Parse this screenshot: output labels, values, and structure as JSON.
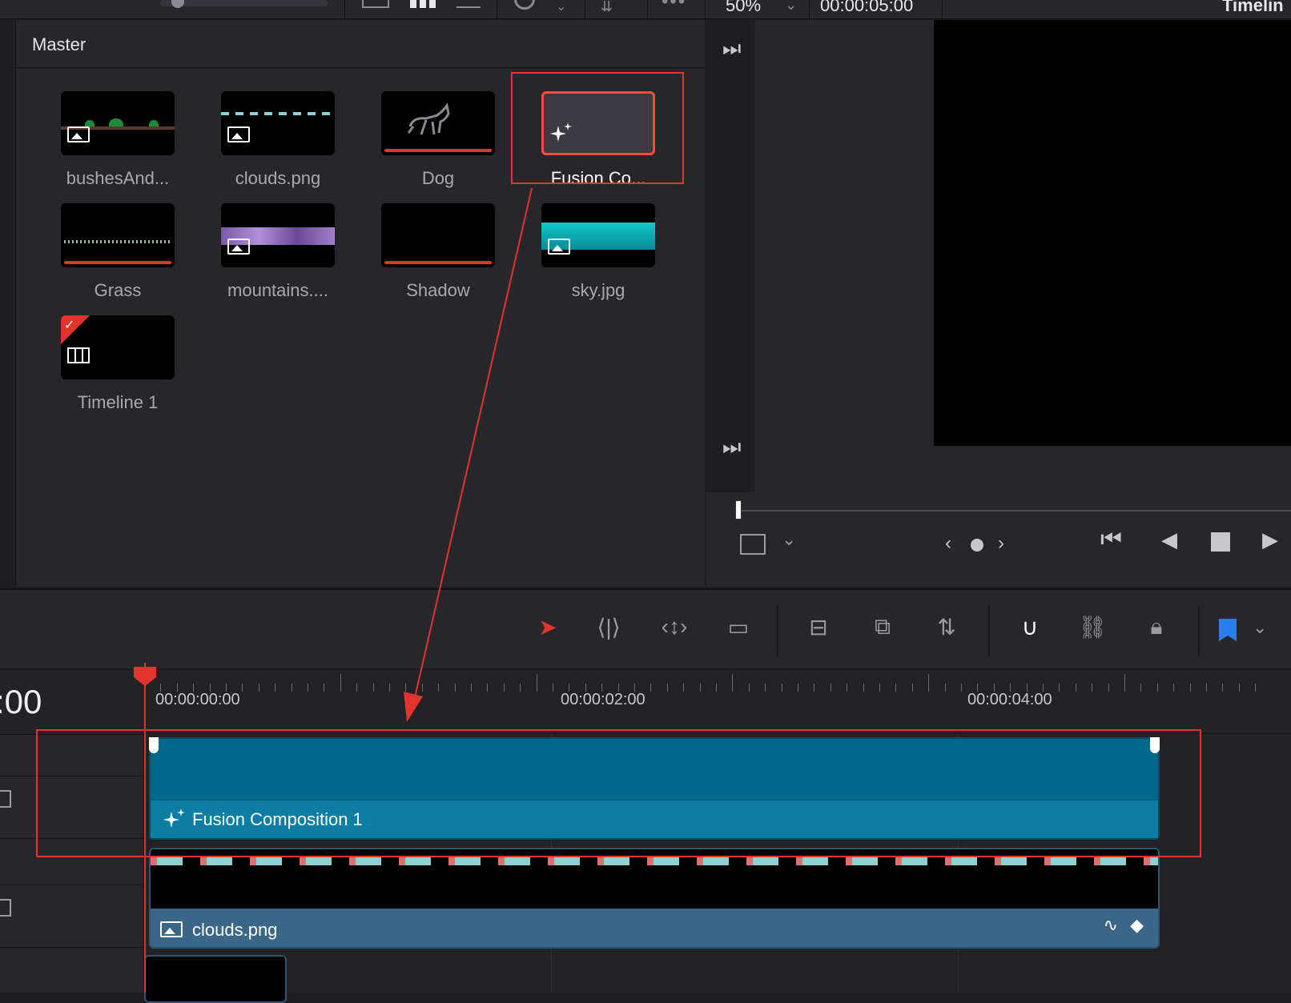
{
  "topbar": {
    "zoom": "50%",
    "timecode": "00:00:05:00",
    "panel_title": "Timelin"
  },
  "media_pool": {
    "folder": "Master",
    "clips": [
      {
        "name": "bushesAnd...",
        "type": "image"
      },
      {
        "name": "clouds.png",
        "type": "image"
      },
      {
        "name": "Dog",
        "type": "fusion"
      },
      {
        "name": "Fusion Co...",
        "type": "fusion",
        "selected": true
      },
      {
        "name": "Grass",
        "type": "fusion"
      },
      {
        "name": "mountains....",
        "type": "image"
      },
      {
        "name": "Shadow",
        "type": "fusion"
      },
      {
        "name": "sky.jpg",
        "type": "image"
      },
      {
        "name": "Timeline 1",
        "type": "timeline"
      }
    ]
  },
  "timeline": {
    "current_time": ":00",
    "ruler_labels": [
      "00:00:00:00",
      "00:00:02:00",
      "00:00:04:00"
    ],
    "tracks": [
      {
        "clip": "Fusion Composition 1",
        "color": "#00688a"
      },
      {
        "clip": "clouds.png",
        "color": "#3a6788"
      }
    ]
  },
  "colors": {
    "accent_red": "#e0342c",
    "flag_blue": "#2a7ff0",
    "fusion_clip": "#00688a"
  }
}
